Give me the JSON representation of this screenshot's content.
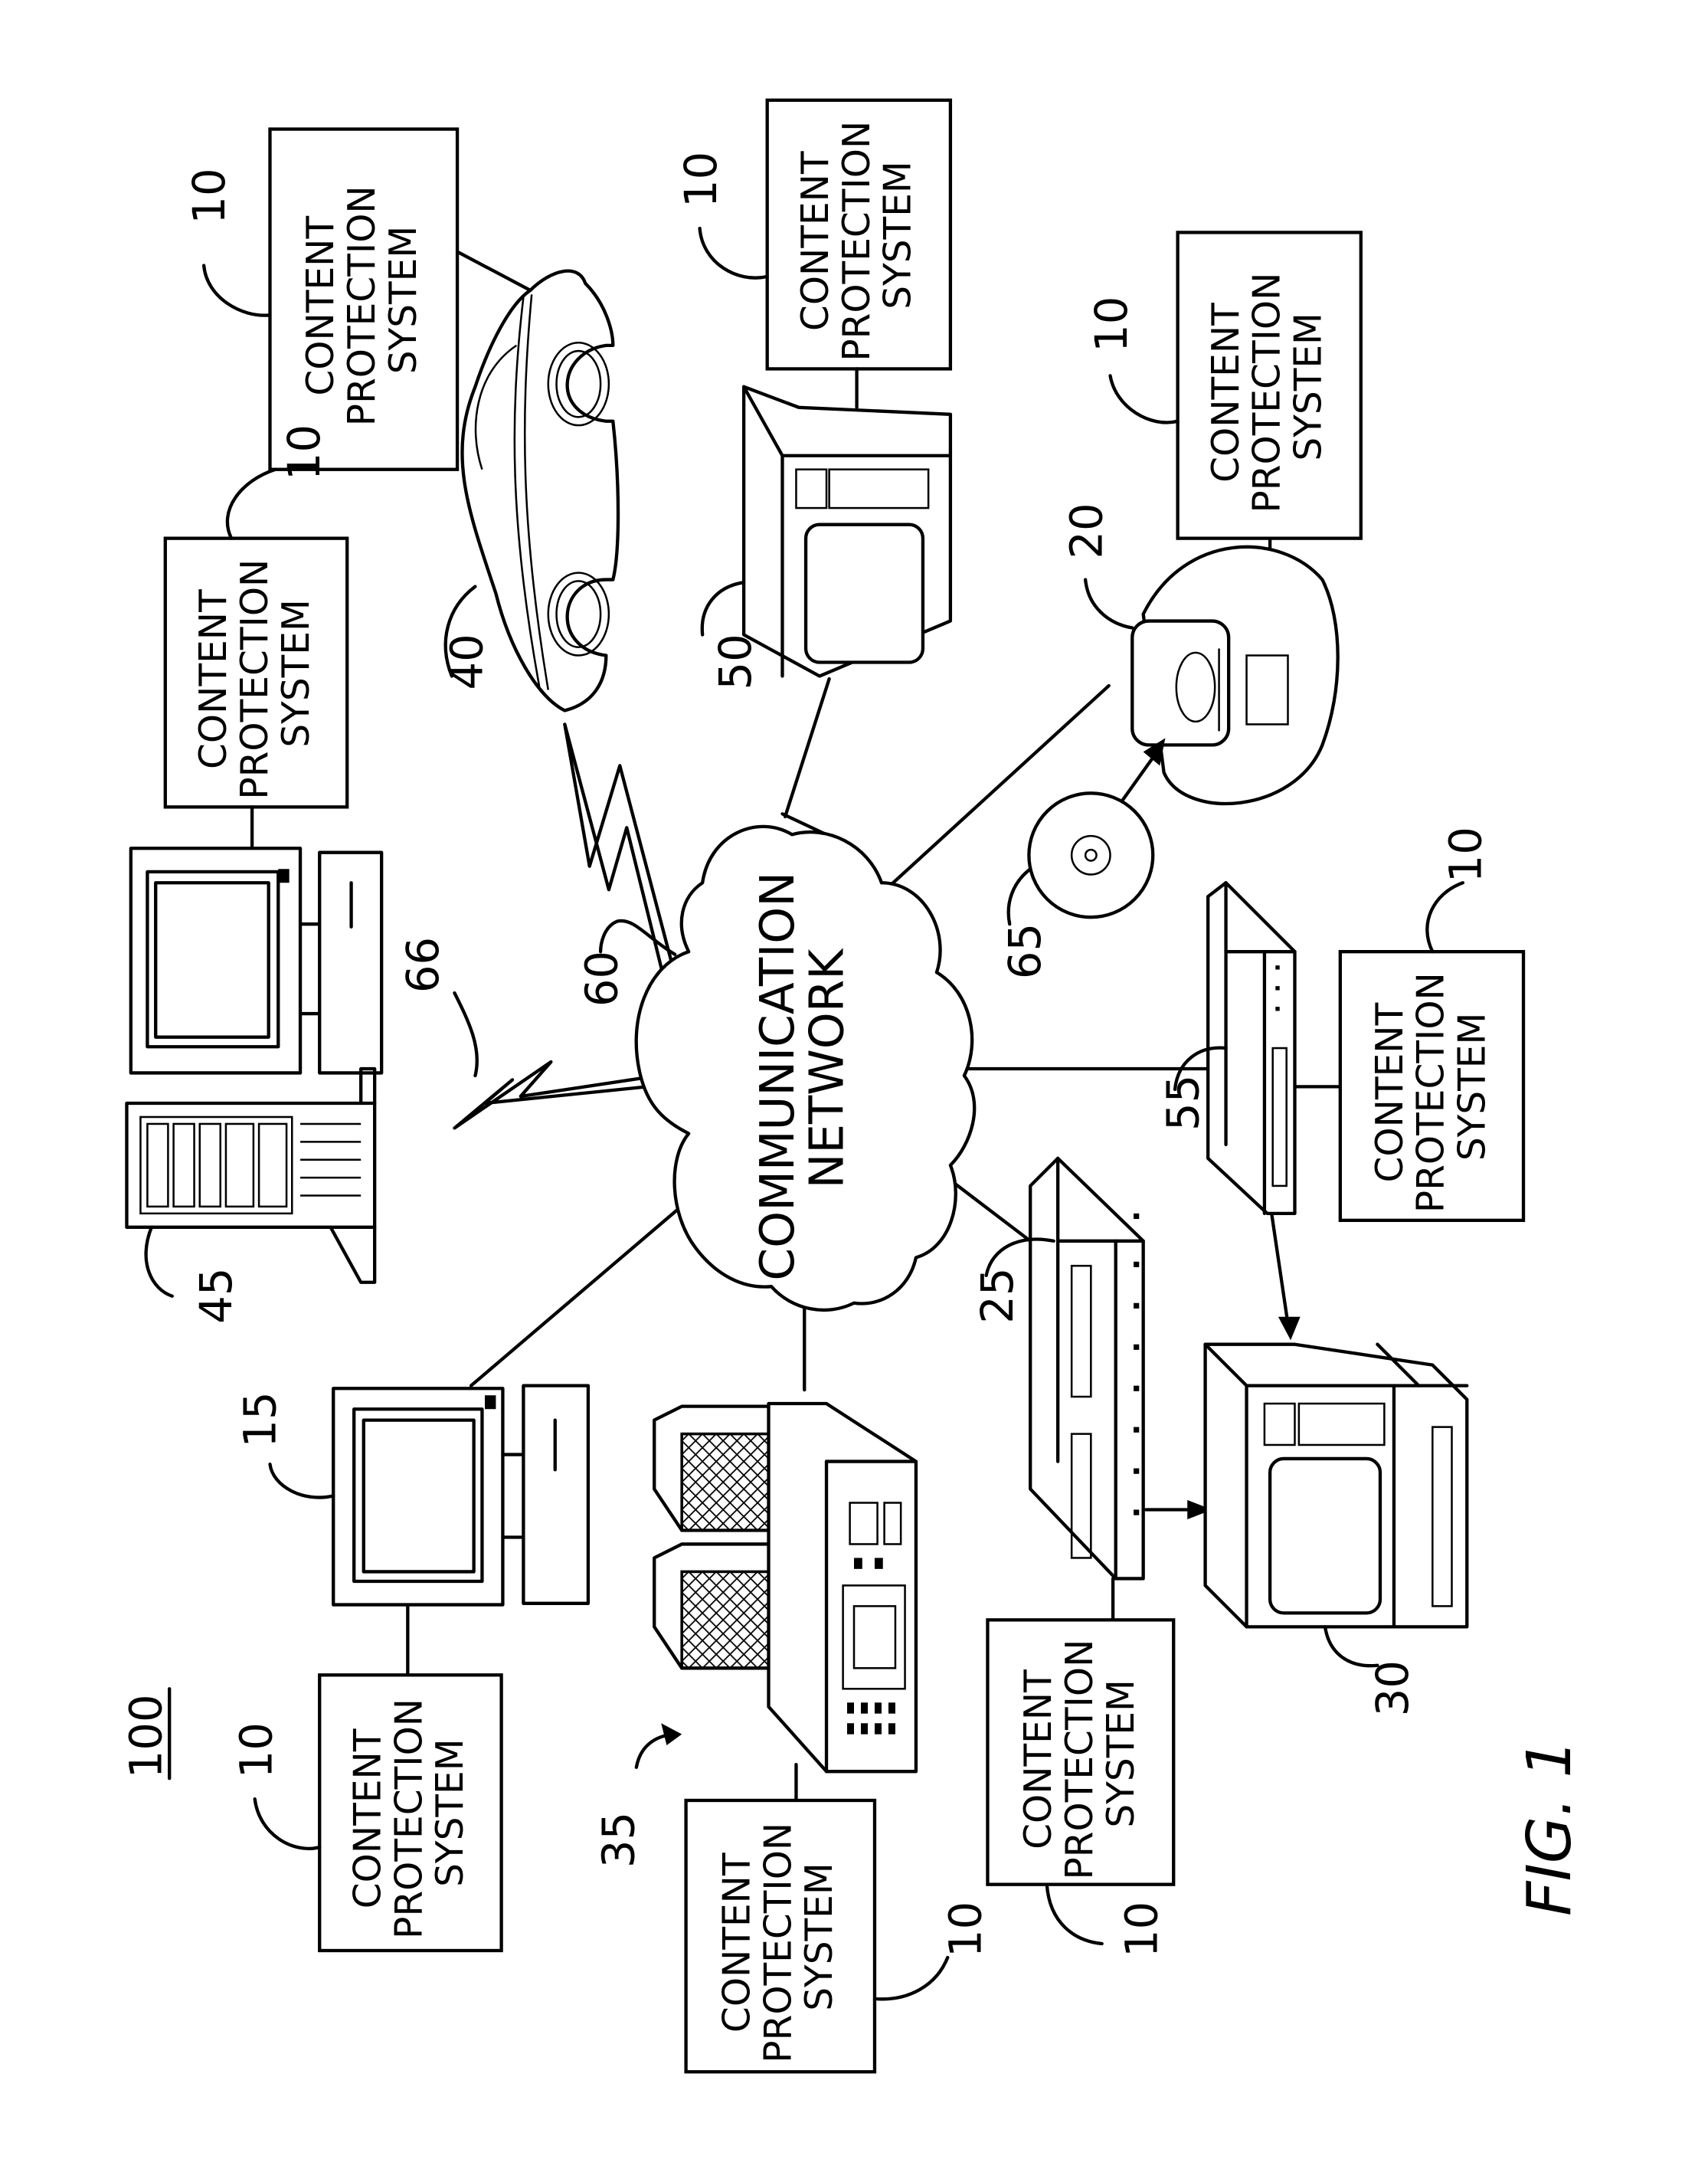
{
  "figure": {
    "label": "FIG. 1",
    "system_ref": "100"
  },
  "network": {
    "line1": "COMMUNICATION",
    "line2": "NETWORK",
    "ref": "60"
  },
  "cps": {
    "line1": "CONTENT",
    "line2": "PROTECTION",
    "line3": "SYSTEM",
    "ref": "10"
  },
  "devices": [
    {
      "id": "computer-15",
      "ref": "15",
      "kind": "personal computer"
    },
    {
      "id": "boombox-20",
      "ref": "20",
      "kind": "portable audio player"
    },
    {
      "id": "vcr-25",
      "ref": "25",
      "kind": "video recorder"
    },
    {
      "id": "tv-30",
      "ref": "30",
      "kind": "television with VCR"
    },
    {
      "id": "stereo-35",
      "ref": "35",
      "kind": "stereo system"
    },
    {
      "id": "car-40",
      "ref": "40",
      "kind": "automobile"
    },
    {
      "id": "server-45",
      "ref": "45",
      "kind": "server"
    },
    {
      "id": "tv-50",
      "ref": "50",
      "kind": "television"
    },
    {
      "id": "settop-55",
      "ref": "55",
      "kind": "set-top box"
    },
    {
      "id": "disc-65",
      "ref": "65",
      "kind": "optical disc"
    },
    {
      "id": "wireless-66",
      "ref": "66",
      "kind": "wireless link"
    }
  ]
}
